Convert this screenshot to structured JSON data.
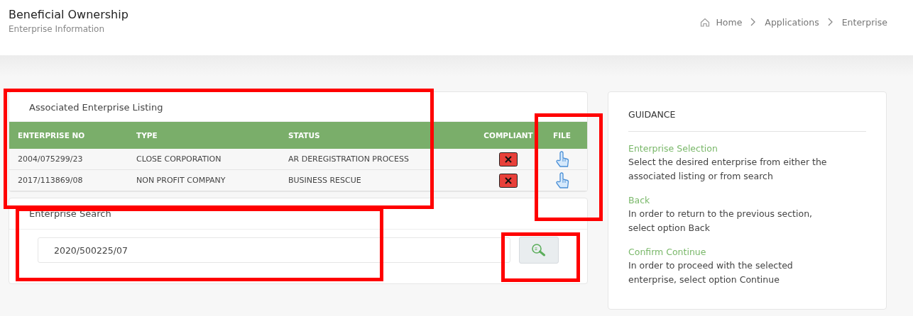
{
  "header": {
    "title": "Beneficial Ownership",
    "subtitle": "Enterprise Information"
  },
  "breadcrumb": [
    "Home",
    "Applications",
    "Enterprise"
  ],
  "listing": {
    "title": "Associated Enterprise Listing",
    "columns": [
      "ENTERPRISE NO",
      "TYPE",
      "STATUS",
      "COMPLIANT",
      "FILE"
    ],
    "rows": [
      {
        "enterprise_no": "2004/075299/23",
        "type": "CLOSE CORPORATION",
        "status": "AR DEREGISTRATION PROCESS",
        "compliant": false
      },
      {
        "enterprise_no": "2017/113869/08",
        "type": "NON PROFIT COMPANY",
        "status": "BUSINESS RESCUE",
        "compliant": false
      }
    ]
  },
  "search": {
    "title": "Enterprise Search",
    "value": "2020/500225/07"
  },
  "guidance": {
    "title": "GUIDANCE",
    "sections": [
      {
        "heading": "Enterprise Selection",
        "text": "Select the desired enterprise from either the associated listing or from search"
      },
      {
        "heading": "Back",
        "text": "In order to return to the previous section, select option Back"
      },
      {
        "heading": "Confirm Continue",
        "text": "In order to proceed with the selected enterprise, select option Continue"
      }
    ]
  }
}
